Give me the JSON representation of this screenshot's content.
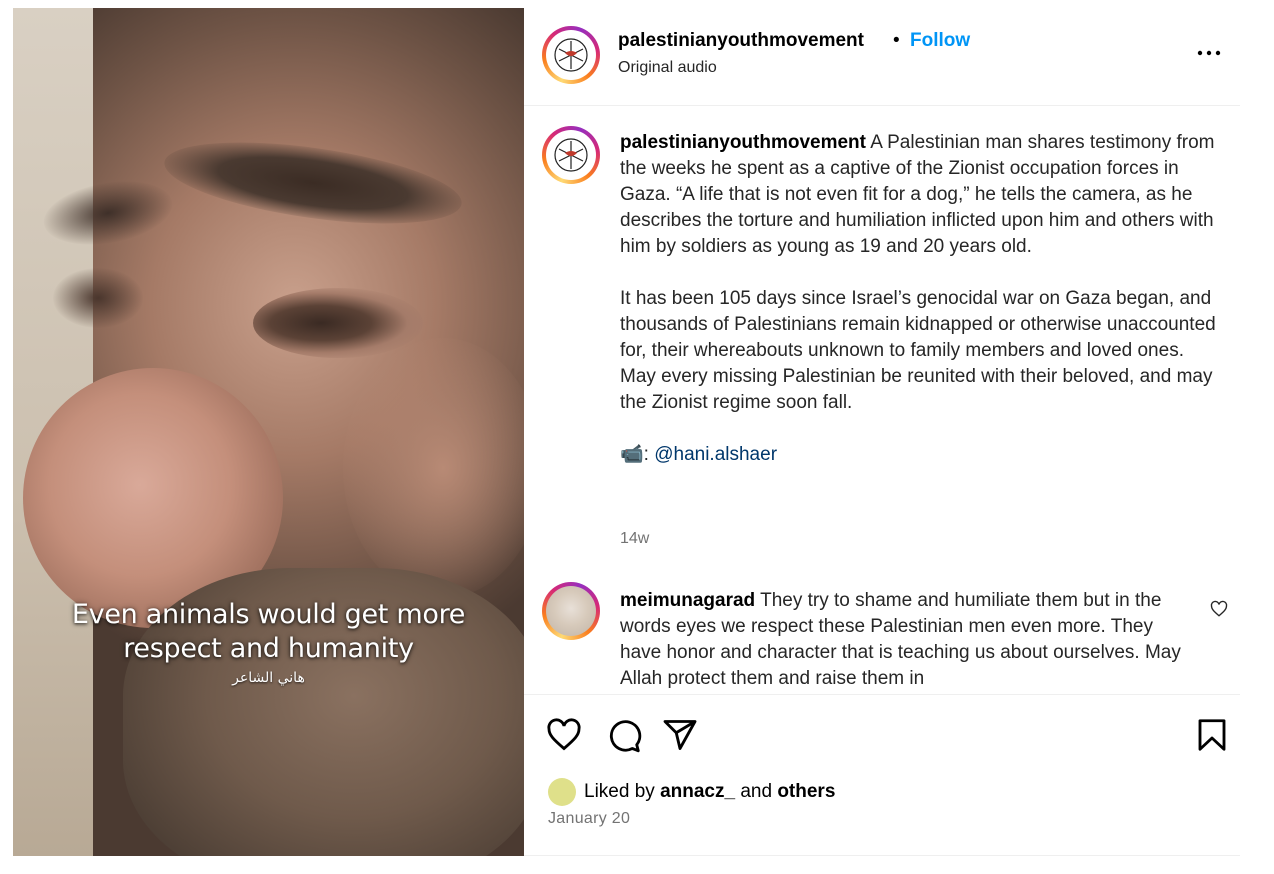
{
  "media": {
    "caption_lines": [
      "Even animals would get more",
      "respect and humanity"
    ],
    "caption_credit": "هاني الشاعر"
  },
  "header": {
    "username": "palestinianyouthmovement",
    "separator": "•",
    "follow_label": "Follow",
    "audio_label": "Original audio"
  },
  "post": {
    "username": "palestinianyouthmovement",
    "paragraph1": "A Palestinian man shares testimony from the weeks he spent as a captive of the Zionist occupation forces in Gaza. “A life that is not even fit for a dog,” he tells the camera, as he describes the torture and humiliation inflicted upon him and others with him by soldiers as young as 19 and 20 years old.",
    "paragraph2": "It has been 105 days since Israel’s genocidal war on Gaza began, and thousands of Palestinians remain kidnapped or otherwise unaccounted for, their whereabouts unknown to family members and loved ones. May every missing Palestinian be reunited with their beloved, and may the Zionist regime soon fall.",
    "credit_prefix": "📹: ",
    "credit_mention": "@hani.alshaer",
    "time_ago": "14w"
  },
  "comment": {
    "username": "meimunagarad",
    "text": "They try to shame and humiliate them but in the words eyes we respect these Palestinian men even more. They have honor and character that is teaching us about ourselves. May Allah protect them and raise them in"
  },
  "likes": {
    "prefix": "Liked by",
    "user": "annacz_",
    "and": "and",
    "others": "others"
  },
  "date": "January 20",
  "colors": {
    "accent": "#0095f6",
    "mention": "#00376b",
    "secondary_text": "#737373",
    "divider": "#efefef"
  },
  "icons": [
    "more-options-icon",
    "like-icon",
    "comment-icon",
    "share-icon",
    "save-icon",
    "comment-like-icon"
  ]
}
